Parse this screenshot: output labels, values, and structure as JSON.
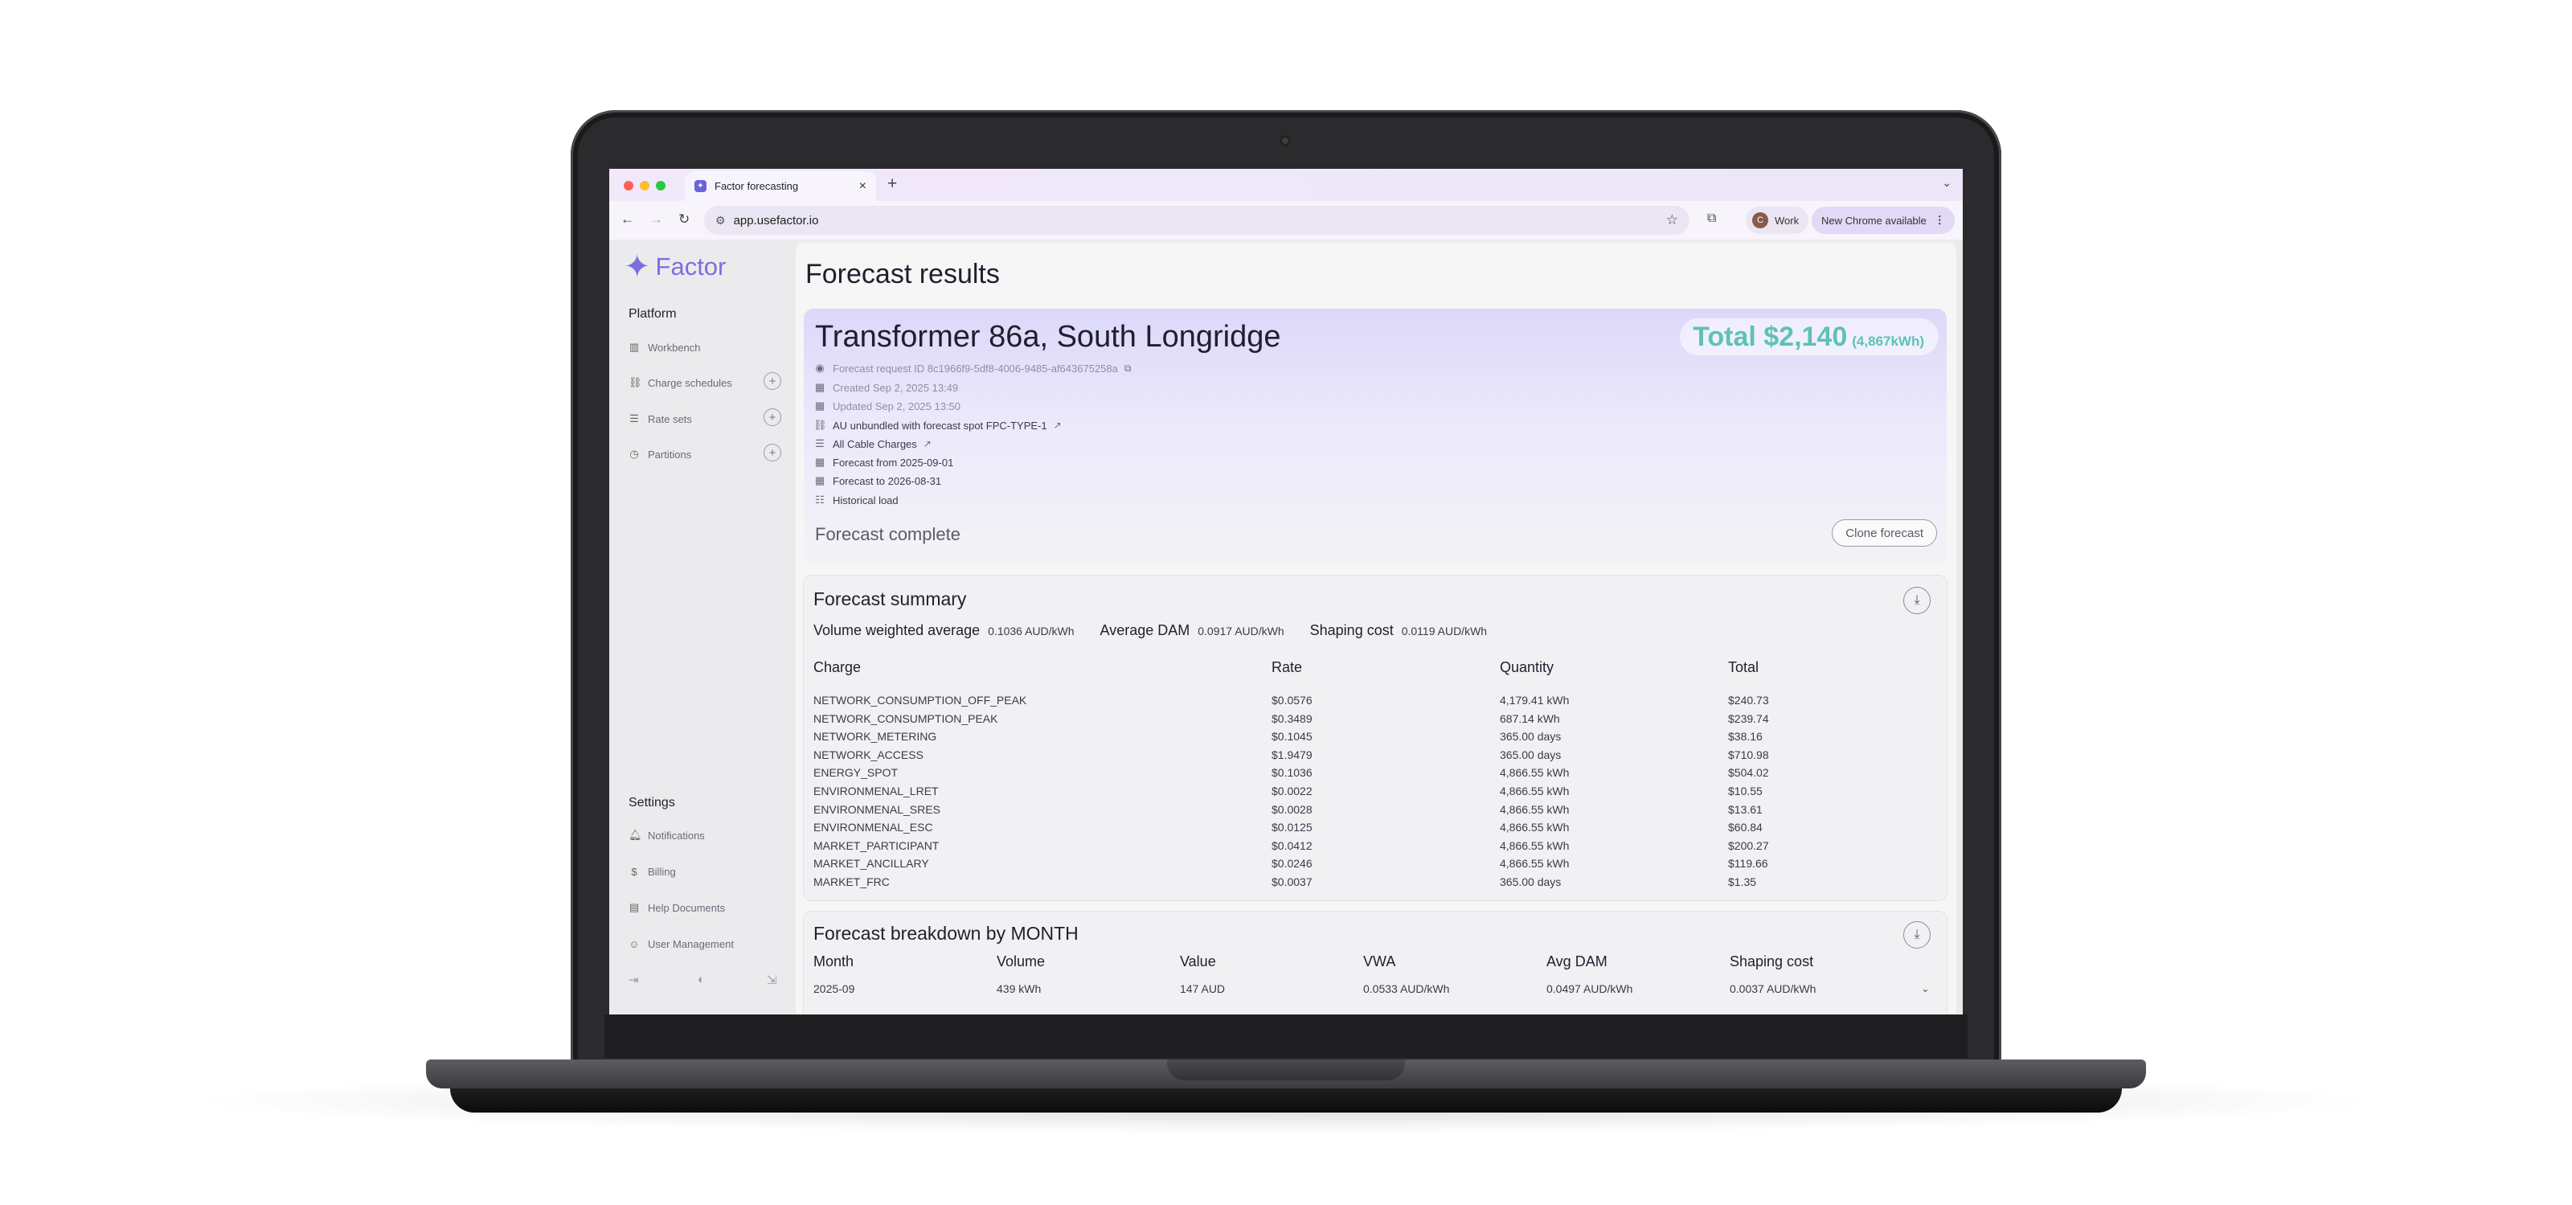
{
  "browser": {
    "tab_title": "Factor forecasting",
    "url": "app.usefactor.io",
    "profile_initial": "C",
    "profile_label": "Work",
    "update_label": "New Chrome available"
  },
  "sidebar": {
    "logo": "Factor",
    "platform_heading": "Platform",
    "platform_items": [
      {
        "label": "Workbench"
      },
      {
        "label": "Charge schedules"
      },
      {
        "label": "Rate sets"
      },
      {
        "label": "Partitions"
      }
    ],
    "settings_heading": "Settings",
    "settings_items": [
      {
        "label": "Notifications"
      },
      {
        "label": "Billing"
      },
      {
        "label": "Help Documents"
      },
      {
        "label": "User Management"
      }
    ]
  },
  "page": {
    "title": "Forecast results"
  },
  "forecast": {
    "title": "Transformer 86a, South Longridge",
    "total": "Total $2,140",
    "total_kwh": "(4,867kWh)",
    "request_id": "Forecast request ID 8c1966f9-5df8-4006-9485-af643675258a",
    "created": "Created Sep 2, 2025 13:49",
    "updated": "Updated Sep 2, 2025 13:50",
    "rate_schedule": "AU unbundled with forecast spot FPC-TYPE-1",
    "charges": "All Cable Charges",
    "forecast_from": "Forecast from 2025-09-01",
    "forecast_to": "Forecast to 2026-08-31",
    "load": "Historical load",
    "status": "Forecast complete",
    "clone_label": "Clone forecast"
  },
  "summary": {
    "title": "Forecast summary",
    "vwa_label": "Volume weighted average",
    "vwa_value": "0.1036 AUD/kWh",
    "dam_label": "Average DAM",
    "dam_value": "0.0917 AUD/kWh",
    "shaping_label": "Shaping cost",
    "shaping_value": "0.0119 AUD/kWh",
    "columns": [
      "Charge",
      "Rate",
      "Quantity",
      "Total"
    ],
    "rows": [
      [
        "NETWORK_CONSUMPTION_OFF_PEAK",
        "$0.0576",
        "4,179.41 kWh",
        "$240.73"
      ],
      [
        "NETWORK_CONSUMPTION_PEAK",
        "$0.3489",
        "687.14 kWh",
        "$239.74"
      ],
      [
        "NETWORK_METERING",
        "$0.1045",
        "365.00 days",
        "$38.16"
      ],
      [
        "NETWORK_ACCESS",
        "$1.9479",
        "365.00 days",
        "$710.98"
      ],
      [
        "ENERGY_SPOT",
        "$0.1036",
        "4,866.55 kWh",
        "$504.02"
      ],
      [
        "ENVIRONMENAL_LRET",
        "$0.0022",
        "4,866.55 kWh",
        "$10.55"
      ],
      [
        "ENVIRONMENAL_SRES",
        "$0.0028",
        "4,866.55 kWh",
        "$13.61"
      ],
      [
        "ENVIRONMENAL_ESC",
        "$0.0125",
        "4,866.55 kWh",
        "$60.84"
      ],
      [
        "MARKET_PARTICIPANT",
        "$0.0412",
        "4,866.55 kWh",
        "$200.27"
      ],
      [
        "MARKET_ANCILLARY",
        "$0.0246",
        "4,866.55 kWh",
        "$119.66"
      ],
      [
        "MARKET_FRC",
        "$0.0037",
        "365.00 days",
        "$1.35"
      ]
    ]
  },
  "breakdown": {
    "title": "Forecast breakdown by MONTH",
    "columns": [
      "Month",
      "Volume",
      "Value",
      "VWA",
      "Avg DAM",
      "Shaping cost"
    ],
    "rows": [
      [
        "2025-09",
        "439 kWh",
        "147 AUD",
        "0.0533 AUD/kWh",
        "0.0497 AUD/kWh",
        "0.0037 AUD/kWh"
      ]
    ]
  },
  "icons": {
    "download": "download-icon",
    "external": "external-link-icon",
    "copy": "copy-icon"
  },
  "colors": {
    "brand": "#7b6fe0",
    "total": "#5fc1b6"
  }
}
